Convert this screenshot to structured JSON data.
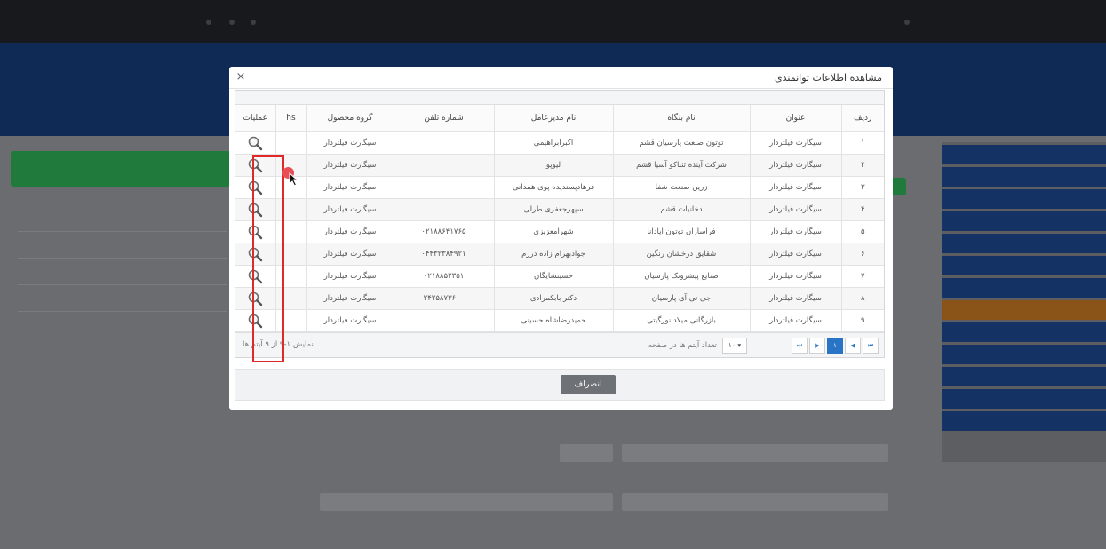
{
  "modal": {
    "title": "مشاهده اطلاعات توانمندی",
    "close_label": "×",
    "cancel_label": "انصراف"
  },
  "table": {
    "columns": [
      "ردیف",
      "عنوان",
      "نام بنگاه",
      "نام مدیرعامل",
      "شماره تلفن",
      "گروه محصول",
      "hs",
      "عملیات"
    ],
    "rows": [
      [
        "۱",
        "سیگارت فیلتردار",
        "توتون صنعت پارسیان قشم",
        "اکبرابراهیمی",
        "",
        "سیگارت فیلتردار",
        ""
      ],
      [
        "۲",
        "سیگارت فیلتردار",
        "شرکت آینده تنباکو آسیا قشم",
        "لیوپو",
        "",
        "سیگارت فیلتردار",
        ""
      ],
      [
        "۳",
        "سیگارت فیلتردار",
        "زرین صنعت شفا",
        "فرهادپسندیده پوی همدانی",
        "",
        "سیگارت فیلتردار",
        ""
      ],
      [
        "۴",
        "سیگارت فیلتردار",
        "دخانیات قشم",
        "سپهرجعفری طرلی",
        "",
        "سیگارت فیلتردار",
        ""
      ],
      [
        "۵",
        "سیگارت فیلتردار",
        "فراسازان توتون آپادانا",
        "شهرامعزیزی",
        "۰۲۱۸۸۶۴۱۷۶۵",
        "سیگارت فیلتردار",
        ""
      ],
      [
        "۶",
        "سیگارت فیلتردار",
        "شقایق درخشان رنگین",
        "جوادبهرام زاده درزم",
        "۰۴۴۳۲۳۸۴۹۲۱",
        "سیگارت فیلتردار",
        ""
      ],
      [
        "۷",
        "سیگارت فیلتردار",
        "صنایع پیشروتک پارسیان",
        "حسینشایگان",
        "۰۲۱۸۸۵۲۳۵۱",
        "سیگارت فیلتردار",
        ""
      ],
      [
        "۸",
        "سیگارت فیلتردار",
        "جی تی آی پارسیان",
        "دکتر بابکمرادی",
        "۲۴۲۵۸۷۳۶۰۰",
        "سیگارت فیلتردار",
        ""
      ],
      [
        "۹",
        "سیگارت فیلتردار",
        "بازرگانی میلاد نورگیتی",
        "حمیدرضاشاه حسینی",
        "",
        "سیگارت فیلتردار",
        ""
      ]
    ],
    "row_action_icon": "magnifier-icon"
  },
  "pager": {
    "info": "نمایش ۱-۹ از ۹ آیتم ها",
    "page_size_label": "تعداد آیتم ها در صفحه",
    "page_size": "۱۰ ▾",
    "current_page": "۱",
    "first": "⏮",
    "prev": "◀",
    "next": "▶",
    "last": "⏭"
  },
  "colors": {
    "accent": "#2a74c6",
    "highlight": "#e02828",
    "cancel": "#6e7175"
  }
}
